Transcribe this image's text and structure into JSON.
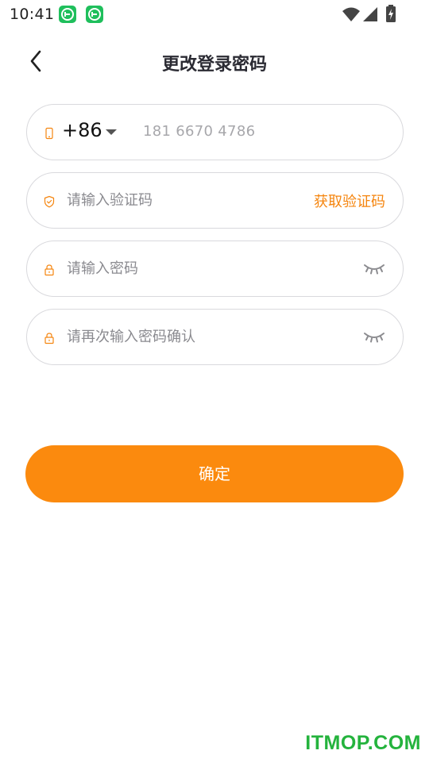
{
  "status_bar": {
    "time": "10:41",
    "notification_icons": [
      "app-notification-icon",
      "app-notification-icon"
    ],
    "right_icons": [
      "wifi-icon",
      "signal-icon",
      "battery-charging-icon"
    ]
  },
  "header": {
    "back_icon": "chevron-left-icon",
    "title": "更改登录密码"
  },
  "form": {
    "phone": {
      "icon": "phone-icon",
      "country_code": "+86",
      "value": "181 6670 4786"
    },
    "verify_code": {
      "icon": "shield-icon",
      "placeholder": "请输入验证码",
      "action_label": "获取验证码"
    },
    "password": {
      "icon": "lock-icon",
      "placeholder": "请输入密码",
      "toggle_icon": "eye-closed-icon"
    },
    "confirm_password": {
      "icon": "lock-icon",
      "placeholder": "请再次输入密码确认",
      "toggle_icon": "eye-closed-icon"
    }
  },
  "submit_label": "确定",
  "watermark": "ITMOP.COM",
  "colors": {
    "accent": "#fb8a0e",
    "accent_text": "#f5850f",
    "border": "#d9d9dd",
    "title": "#2b2b33",
    "watermark": "#24b33d"
  }
}
